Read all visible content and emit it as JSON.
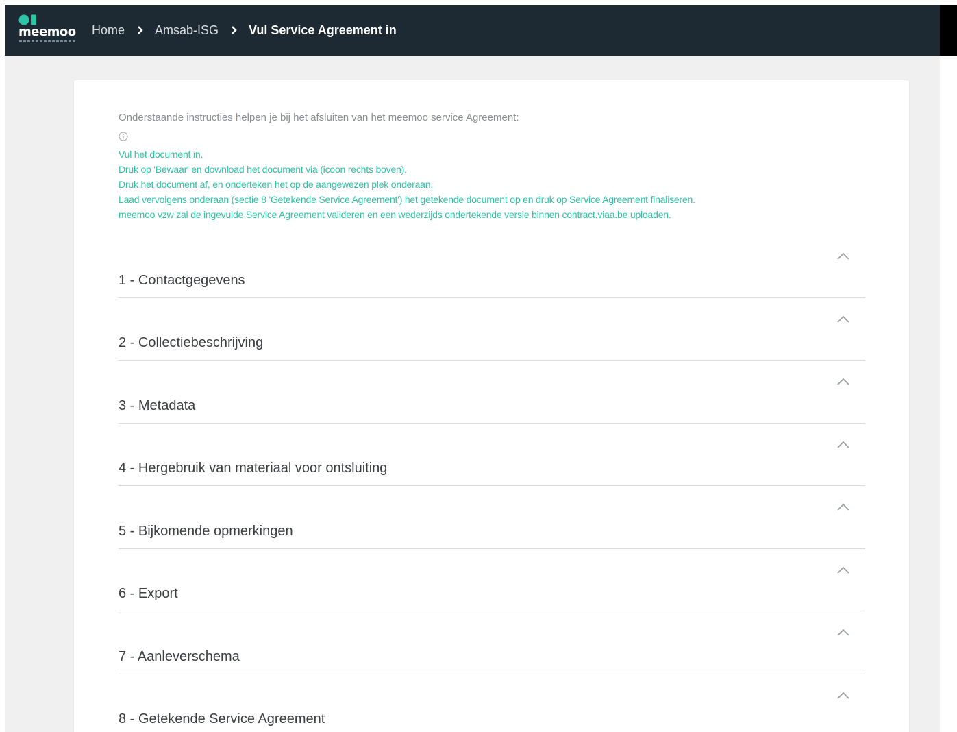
{
  "header": {
    "logo_text": "meemoo",
    "breadcrumb": [
      {
        "label": "Home"
      },
      {
        "label": "Amsab-ISG"
      },
      {
        "label": "Vul Service Agreement in"
      }
    ],
    "colors": {
      "topbar": "#1e2a33",
      "accent": "#2ec4a6"
    }
  },
  "main": {
    "intro": "Onderstaande instructies helpen je bij het afsluiten van het meemoo service Agreement:",
    "info_icon": "info-circle-icon",
    "instructions": [
      "Vul het document in.",
      "Druk op 'Bewaar' en download het document via (icoon rechts boven).",
      "Druk het document af, en onderteken het op de aangewezen plek onderaan.",
      "Laad vervolgens onderaan (sectie 8 'Getekende Service Agreement') het getekende document op en druk op Service Agreement finaliseren.",
      "meemoo vzw zal de ingevulde Service Agreement valideren en een wederzijds ondertekende versie binnen contract.viaa.be uploaden."
    ],
    "sections": [
      {
        "title": "1 - Contactgegevens",
        "icon": "chevron-up-icon"
      },
      {
        "title": "2 - Collectiebeschrijving",
        "icon": "chevron-up-icon"
      },
      {
        "title": "3 - Metadata",
        "icon": "chevron-up-icon"
      },
      {
        "title": "4 - Hergebruik van materiaal voor ontsluiting",
        "icon": "chevron-up-icon"
      },
      {
        "title": "5 - Bijkomende opmerkingen",
        "icon": "chevron-up-icon"
      },
      {
        "title": "6 - Export",
        "icon": "chevron-up-icon"
      },
      {
        "title": "7 - Aanleverschema",
        "icon": "chevron-up-icon"
      },
      {
        "title": "8 - Getekende Service Agreement",
        "icon": "chevron-up-icon"
      }
    ]
  }
}
